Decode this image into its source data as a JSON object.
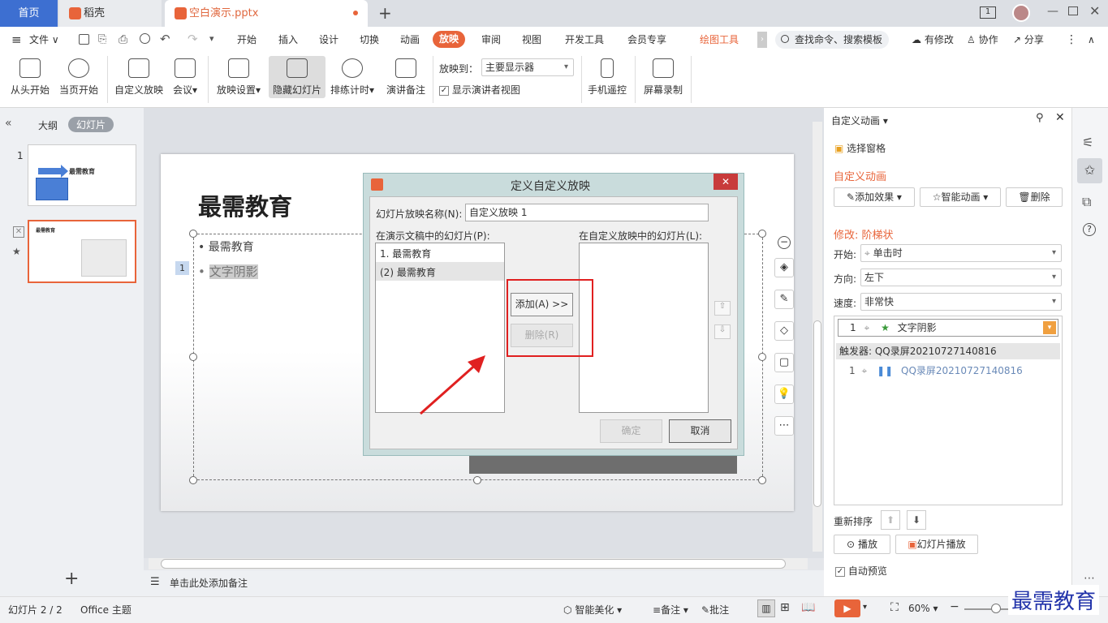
{
  "tabs": {
    "home": "首页",
    "daoke": "稻壳",
    "file": "空白演示.pptx"
  },
  "menu": {
    "file": "文件",
    "items": [
      "开始",
      "插入",
      "设计",
      "切换",
      "动画",
      "放映",
      "审阅",
      "视图",
      "开发工具",
      "会员专享"
    ],
    "active": "放映",
    "drawing_tools": "绘图工具",
    "search": "查找命令、搜索模板",
    "modified": "有修改",
    "collab": "协作",
    "share": "分享"
  },
  "ribbon": {
    "from_start": "从头开始",
    "from_current": "当页开始",
    "custom_show": "自定义放映",
    "meeting": "会议",
    "show_settings": "放映设置",
    "hide_slide": "隐藏幻灯片",
    "rehearse": "排练计时",
    "speaker_notes": "演讲备注",
    "show_to_label": "放映到：",
    "show_to_value": "主要显示器",
    "presenter_view": "显示演讲者视图",
    "phone_remote": "手机遥控",
    "screen_record": "屏幕录制"
  },
  "left_panel": {
    "tab_outline": "大纲",
    "tab_slides": "幻灯片",
    "slide1_num": "1",
    "slide1_title": "最需教育",
    "slide2_num": "2",
    "add": "+"
  },
  "slide": {
    "title": "最需教育",
    "bullet1": "最需教育",
    "bullet2": "文字阴影",
    "anim_tag": "1"
  },
  "dialog": {
    "title": "定义自定义放映",
    "name_label": "幻灯片放映名称(N):",
    "name_value": "自定义放映 1",
    "left_list_label": "在演示文稿中的幻灯片(P):",
    "left_items": [
      "1. 最需教育",
      "(2) 最需教育"
    ],
    "right_list_label": "在自定义放映中的幻灯片(L):",
    "add_button": "添加(A) >>",
    "remove_button": "删除(R)",
    "ok": "确定",
    "cancel": "取消"
  },
  "notes": {
    "placeholder": "单击此处添加备注"
  },
  "right_panel": {
    "header": "自定义动画",
    "select_pane": "选择窗格",
    "section_title": "自定义动画",
    "add_effect": "添加效果",
    "smart_anim": "智能动画",
    "delete": "删除",
    "modify": "修改: 阶梯状",
    "start_label": "开始:",
    "start_value": "单击时",
    "direction_label": "方向:",
    "direction_value": "左下",
    "speed_label": "速度:",
    "speed_value": "非常快",
    "anim_item_num": "1",
    "anim_item": "文字阴影",
    "trigger": "触发器: QQ录屏20210727140816",
    "trigger_item_num": "1",
    "trigger_item": "QQ录屏20210727140816",
    "reorder": "重新排序",
    "play": "播放",
    "slideshow": "幻灯片播放",
    "autopreview": "自动预览"
  },
  "status": {
    "slide_count": "幻灯片 2 / 2",
    "theme": "Office 主题",
    "beautify": "智能美化",
    "notes": "备注",
    "comments": "批注",
    "zoom": "60%",
    "watermark": "最需教育"
  }
}
